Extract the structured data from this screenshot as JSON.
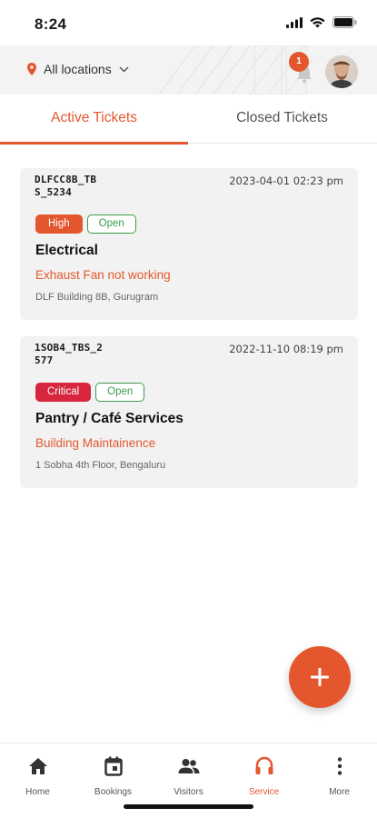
{
  "status_bar": {
    "time": "8:24"
  },
  "header": {
    "location_label": "All locations",
    "notification_count": "1"
  },
  "tabs": [
    {
      "label": "Active Tickets",
      "active": true
    },
    {
      "label": "Closed Tickets",
      "active": false
    }
  ],
  "tickets": [
    {
      "id": "DLFCC8B_TB\nS_5234",
      "date": "2023-04-01 02:23 pm",
      "priority": "High",
      "status": "Open",
      "category": "Electrical",
      "subcategory": "Exhaust Fan not working",
      "address": "DLF Building 8B, Gurugram"
    },
    {
      "id": "1SOB4_TBS_2\n577",
      "date": "2022-11-10 08:19 pm",
      "priority": "Critical",
      "status": "Open",
      "category": "Pantry / Café Services",
      "subcategory": "Building Maintainence",
      "address": "1 Sobha 4th Floor, Bengaluru"
    }
  ],
  "bottom_nav": [
    {
      "label": "Home",
      "icon": "home-icon"
    },
    {
      "label": "Bookings",
      "icon": "calendar-icon"
    },
    {
      "label": "Visitors",
      "icon": "people-icon"
    },
    {
      "label": "Service",
      "icon": "headphones-icon",
      "active": true
    },
    {
      "label": "More",
      "icon": "more-vertical-icon"
    }
  ],
  "colors": {
    "accent": "#e4572e",
    "critical": "#d7263d",
    "open": "#3a9b4a",
    "card_bg": "#f2f2f2"
  }
}
